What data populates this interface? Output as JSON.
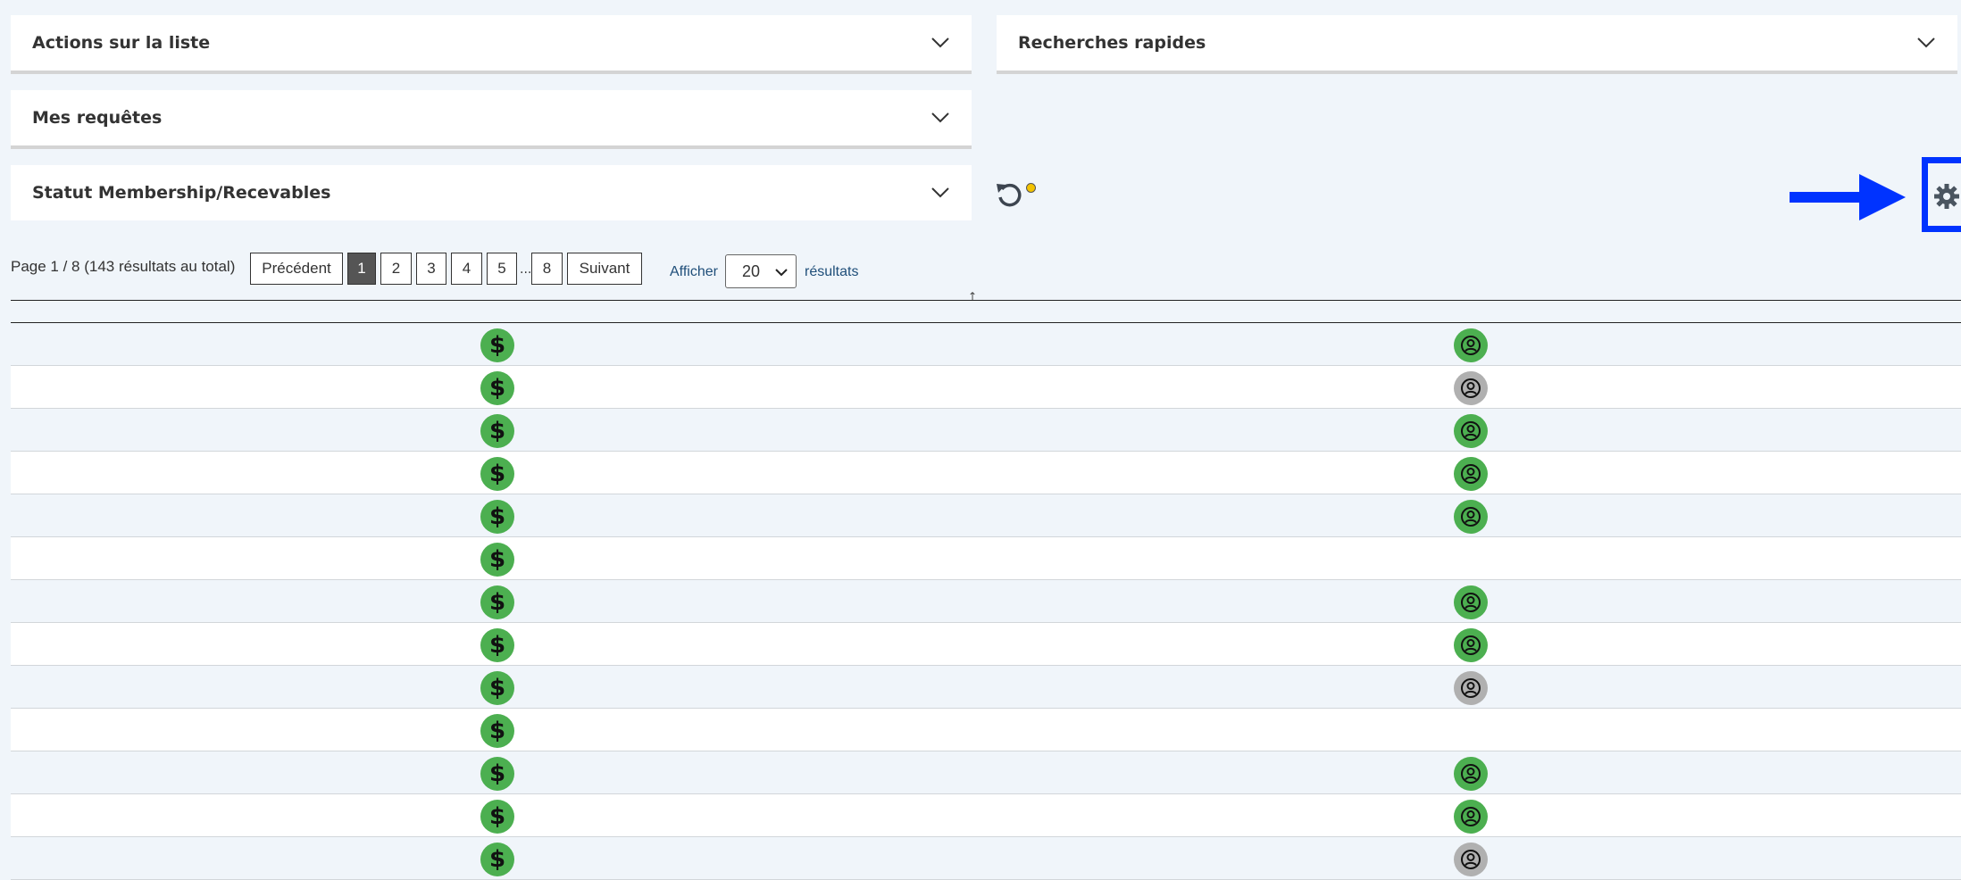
{
  "panels": {
    "actions": "Actions sur la liste",
    "recherches": "Recherches rapides",
    "requetes": "Mes requêtes",
    "statut": "Statut Membership/Recevables"
  },
  "pagination": {
    "info": "Page 1 / 8 (143 résultats au total)",
    "prev": "Précédent",
    "pages": [
      "1",
      "2",
      "3",
      "4",
      "5"
    ],
    "ellipsis": "...",
    "last": "8",
    "next": "Suivant",
    "current": "1"
  },
  "display": {
    "label": "Afficher",
    "value": "20",
    "suffix": "résultats"
  },
  "table": {
    "sort_symbol": "↑",
    "rows": [
      {
        "payment": "$",
        "member": "green"
      },
      {
        "payment": "$",
        "member": "gray"
      },
      {
        "payment": "$",
        "member": "green"
      },
      {
        "payment": "$",
        "member": "green"
      },
      {
        "payment": "$",
        "member": "green"
      },
      {
        "payment": "$",
        "member": "none"
      },
      {
        "payment": "$",
        "member": "green"
      },
      {
        "payment": "$",
        "member": "green"
      },
      {
        "payment": "$",
        "member": "gray"
      },
      {
        "payment": "$",
        "member": "none"
      },
      {
        "payment": "$",
        "member": "green"
      },
      {
        "payment": "$",
        "member": "green"
      },
      {
        "payment": "$",
        "member": "gray"
      }
    ]
  },
  "colors": {
    "status_green": "#4caf50",
    "status_gray": "#b0b0b0",
    "highlight_blue": "#0033ff",
    "notification_dot": "#f2c200"
  }
}
